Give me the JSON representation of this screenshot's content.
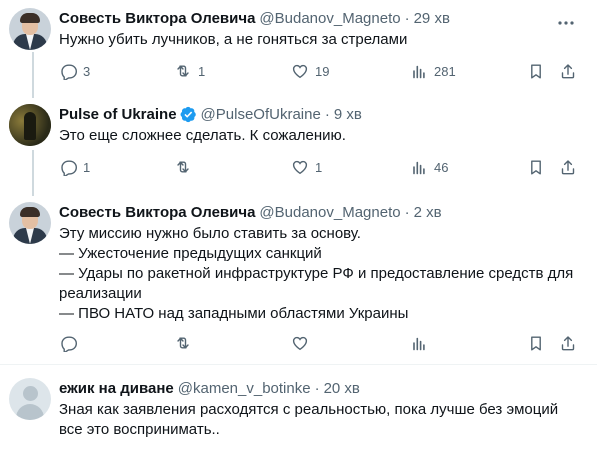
{
  "tweets": [
    {
      "name": "Совесть Виктора Олевича",
      "handle": "@Budanov_Magneto",
      "time": "29 хв",
      "lines": [
        "Нужно убить лучников, а не гоняться за стрелами"
      ],
      "replies": "3",
      "retweets": "1",
      "likes": "19",
      "views": "281",
      "avatar": "person-avatar"
    },
    {
      "name": "Pulse of Ukraine",
      "verified": true,
      "handle": "@PulseOfUkraine",
      "time": "9 хв",
      "lines": [
        "Это еще сложнее сделать. К сожалению."
      ],
      "replies": "1",
      "retweets": "",
      "likes": "1",
      "views": "46",
      "avatar": "pulse-avatar"
    },
    {
      "name": "Совесть Виктора Олевича",
      "handle": "@Budanov_Magneto",
      "time": "2 хв",
      "lines": [
        "Эту миссию нужно было ставить за основу.",
        "— Ужесточение предыдущих санкций",
        "— Удары по ракетной инфраструктуре РФ и предоставление средств для",
        "реализации",
        "— ПВО НАТО над западными областями Украины"
      ],
      "replies": "",
      "retweets": "",
      "likes": "",
      "views": "",
      "avatar": "person-avatar"
    },
    {
      "name": "ежик на диване",
      "handle": "@kamen_v_botinke",
      "time": "20 хв",
      "lines": [
        "Зная как заявления расходятся с реальностью, пока лучше без эмоций",
        "все это  воспринимать.."
      ],
      "avatar": "default-avatar"
    }
  ],
  "dot": "·",
  "icons": [
    "reply-icon",
    "retweet-icon",
    "like-icon",
    "views-icon",
    "bookmark-icon",
    "share-icon",
    "more-icon",
    "verified-icon"
  ],
  "colors": {
    "text": "#0f1419",
    "secondary": "#536471",
    "verified": "#1d9bf0",
    "line": "#cfd9de"
  }
}
